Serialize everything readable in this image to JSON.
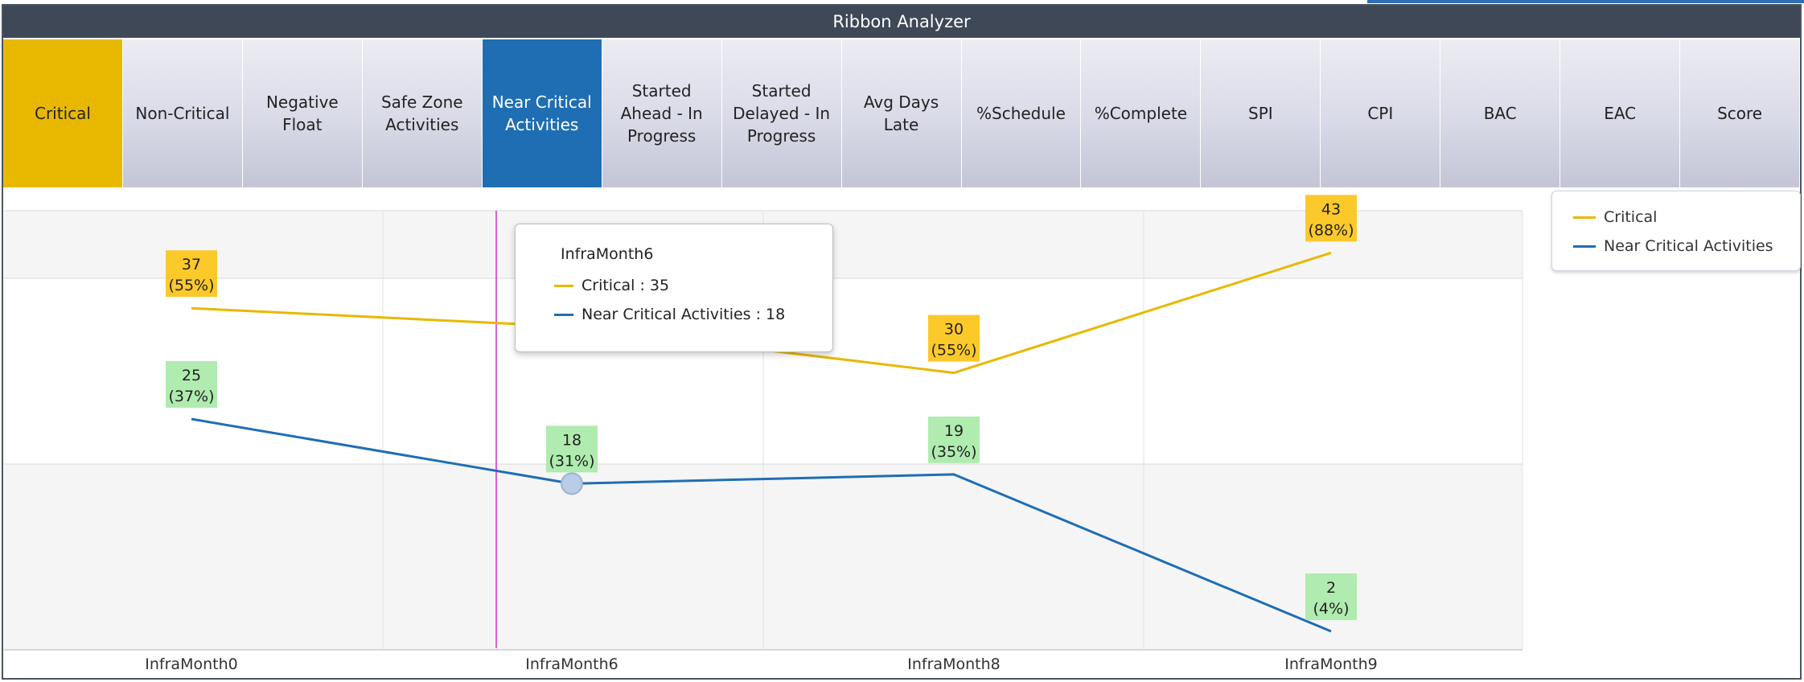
{
  "window": {
    "title": "Ribbon Analyzer"
  },
  "colors": {
    "critical": "#e8b800",
    "near_critical": "#1f6eb3",
    "title_bar": "#3f4856",
    "crosshair": "#cc33cc"
  },
  "ribbon": {
    "items": [
      {
        "label": "Critical",
        "state": "selected-critical"
      },
      {
        "label": "Non-Critical"
      },
      {
        "label": "Negative\nFloat"
      },
      {
        "label": "Safe Zone\nActivities"
      },
      {
        "label": "Near Critical\nActivities",
        "state": "selected-near"
      },
      {
        "label": "Started\nAhead - In\nProgress"
      },
      {
        "label": "Started\nDelayed - In\nProgress"
      },
      {
        "label": "Avg Days\nLate"
      },
      {
        "label": "%Schedule"
      },
      {
        "label": "%Complete"
      },
      {
        "label": "SPI"
      },
      {
        "label": "CPI"
      },
      {
        "label": "BAC"
      },
      {
        "label": "EAC"
      },
      {
        "label": "Score"
      }
    ]
  },
  "tooltip": {
    "title": "InfraMonth6",
    "rows": [
      "Critical : 35",
      "Near Critical Activities : 18"
    ]
  },
  "chart_data": {
    "type": "line",
    "categories": [
      "InfraMonth0",
      "InfraMonth6",
      "InfraMonth8",
      "InfraMonth9"
    ],
    "series": [
      {
        "name": "Critical",
        "color": "#e8b800",
        "values": [
          37,
          35,
          30,
          43
        ],
        "labels": [
          "(55%)",
          "",
          "(55%)",
          "(88%)"
        ]
      },
      {
        "name": "Near Critical Activities",
        "color": "#1f6eb3",
        "values": [
          25,
          18,
          19,
          2
        ],
        "labels": [
          "(37%)",
          "(31%)",
          "(35%)",
          "(4%)"
        ]
      }
    ],
    "ylim": [
      0,
      50
    ],
    "grid": true,
    "legend": "top-right",
    "hover_category": "InfraMonth6"
  }
}
